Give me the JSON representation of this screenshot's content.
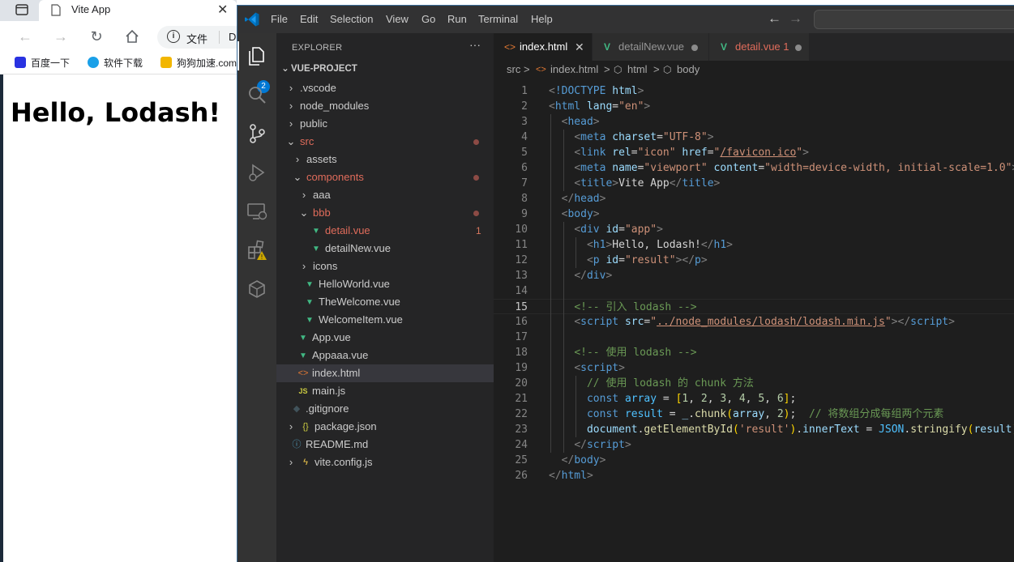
{
  "browser": {
    "tab_title": "Vite App",
    "tab_close": "✕",
    "address_label": "文件",
    "address_text": "D",
    "bookmarks": [
      {
        "label": "百度一下",
        "color": "#2932e1"
      },
      {
        "label": "软件下载",
        "color": "#1aa0e8"
      },
      {
        "label": "狗狗加速.com",
        "color": "#f2b600"
      }
    ],
    "page_heading": "Hello, Lodash!"
  },
  "vscode": {
    "menu": [
      "File",
      "Edit",
      "Selection",
      "View",
      "Go",
      "Run",
      "Terminal",
      "Help"
    ],
    "source_control_badge": "2",
    "explorer": {
      "title": "EXPLORER",
      "more": "···",
      "project": "VUE-PROJECT",
      "items": [
        {
          "label": ".vscode",
          "depth": 0,
          "kind": "folder",
          "open": false
        },
        {
          "label": "node_modules",
          "depth": 0,
          "kind": "folder",
          "open": false
        },
        {
          "label": "public",
          "depth": 0,
          "kind": "folder",
          "open": false
        },
        {
          "label": "src",
          "depth": 0,
          "kind": "folder",
          "open": true,
          "modified": true,
          "dot": true
        },
        {
          "label": "assets",
          "depth": 1,
          "kind": "folder",
          "open": false
        },
        {
          "label": "components",
          "depth": 1,
          "kind": "folder",
          "open": true,
          "modified": true,
          "dot": true
        },
        {
          "label": "aaa",
          "depth": 2,
          "kind": "folder",
          "open": false
        },
        {
          "label": "bbb",
          "depth": 2,
          "kind": "folder",
          "open": true,
          "modified": true,
          "dot": true
        },
        {
          "label": "detail.vue",
          "depth": 3,
          "kind": "vue",
          "modified": true,
          "count": "1"
        },
        {
          "label": "detailNew.vue",
          "depth": 3,
          "kind": "vue"
        },
        {
          "label": "icons",
          "depth": 2,
          "kind": "folder",
          "open": false
        },
        {
          "label": "HelloWorld.vue",
          "depth": 2,
          "kind": "vue"
        },
        {
          "label": "TheWelcome.vue",
          "depth": 2,
          "kind": "vue"
        },
        {
          "label": "WelcomeItem.vue",
          "depth": 2,
          "kind": "vue"
        },
        {
          "label": "App.vue",
          "depth": 1,
          "kind": "vue"
        },
        {
          "label": "Appaaa.vue",
          "depth": 1,
          "kind": "vue"
        },
        {
          "label": "index.html",
          "depth": 1,
          "kind": "html",
          "selected": true
        },
        {
          "label": "main.js",
          "depth": 1,
          "kind": "js"
        },
        {
          "label": ".gitignore",
          "depth": 0,
          "kind": "git"
        },
        {
          "label": "package.json",
          "depth": 0,
          "kind": "json",
          "folded": true
        },
        {
          "label": "README.md",
          "depth": 0,
          "kind": "info"
        },
        {
          "label": "vite.config.js",
          "depth": 0,
          "kind": "vite",
          "folded": true
        }
      ]
    },
    "tabs": [
      {
        "label": "index.html",
        "icon": "<>",
        "active": true,
        "close": "✕"
      },
      {
        "label": "detailNew.vue",
        "icon": "V",
        "dirty": true
      },
      {
        "label": "detail.vue 1",
        "icon": "V",
        "dirty": true,
        "modified": true
      }
    ],
    "breadcrumb": [
      "src",
      ">",
      "index.html",
      ">",
      "html",
      ">",
      "body"
    ],
    "current_line": 15,
    "code_lines": [
      [
        [
          "pn",
          "<"
        ],
        [
          "tg",
          "!DOCTYPE"
        ],
        [
          "tt",
          " "
        ],
        [
          "at",
          "html"
        ],
        [
          "pn",
          ">"
        ]
      ],
      [
        [
          "pn",
          "<"
        ],
        [
          "tg",
          "html"
        ],
        [
          "tt",
          " "
        ],
        [
          "at",
          "lang"
        ],
        [
          "df",
          "="
        ],
        [
          "st",
          "\"en\""
        ],
        [
          "pn",
          ">"
        ]
      ],
      [
        [
          "tt",
          "  "
        ],
        [
          "pn",
          "<"
        ],
        [
          "tg",
          "head"
        ],
        [
          "pn",
          ">"
        ]
      ],
      [
        [
          "tt",
          "    "
        ],
        [
          "pn",
          "<"
        ],
        [
          "tg",
          "meta"
        ],
        [
          "tt",
          " "
        ],
        [
          "at",
          "charset"
        ],
        [
          "df",
          "="
        ],
        [
          "st",
          "\"UTF-8\""
        ],
        [
          "pn",
          ">"
        ]
      ],
      [
        [
          "tt",
          "    "
        ],
        [
          "pn",
          "<"
        ],
        [
          "tg",
          "link"
        ],
        [
          "tt",
          " "
        ],
        [
          "at",
          "rel"
        ],
        [
          "df",
          "="
        ],
        [
          "st",
          "\"icon\""
        ],
        [
          "tt",
          " "
        ],
        [
          "at",
          "href"
        ],
        [
          "df",
          "="
        ],
        [
          "st",
          "\""
        ],
        [
          "lk",
          "/favicon.ico"
        ],
        [
          "st",
          "\""
        ],
        [
          "pn",
          ">"
        ]
      ],
      [
        [
          "tt",
          "    "
        ],
        [
          "pn",
          "<"
        ],
        [
          "tg",
          "meta"
        ],
        [
          "tt",
          " "
        ],
        [
          "at",
          "name"
        ],
        [
          "df",
          "="
        ],
        [
          "st",
          "\"viewport\""
        ],
        [
          "tt",
          " "
        ],
        [
          "at",
          "content"
        ],
        [
          "df",
          "="
        ],
        [
          "st",
          "\"width=device-width, initial-scale=1.0\""
        ],
        [
          "pn",
          ">"
        ]
      ],
      [
        [
          "tt",
          "    "
        ],
        [
          "pn",
          "<"
        ],
        [
          "tg",
          "title"
        ],
        [
          "pn",
          ">"
        ],
        [
          "tt",
          "Vite App"
        ],
        [
          "pn",
          "</"
        ],
        [
          "tg",
          "title"
        ],
        [
          "pn",
          ">"
        ]
      ],
      [
        [
          "tt",
          "  "
        ],
        [
          "pn",
          "</"
        ],
        [
          "tg",
          "head"
        ],
        [
          "pn",
          ">"
        ]
      ],
      [
        [
          "tt",
          "  "
        ],
        [
          "pn",
          "<"
        ],
        [
          "tg",
          "body"
        ],
        [
          "pn",
          ">"
        ]
      ],
      [
        [
          "tt",
          "    "
        ],
        [
          "pn",
          "<"
        ],
        [
          "tg",
          "div"
        ],
        [
          "tt",
          " "
        ],
        [
          "at",
          "id"
        ],
        [
          "df",
          "="
        ],
        [
          "st",
          "\"app\""
        ],
        [
          "pn",
          ">"
        ]
      ],
      [
        [
          "tt",
          "      "
        ],
        [
          "pn",
          "<"
        ],
        [
          "tg",
          "h1"
        ],
        [
          "pn",
          ">"
        ],
        [
          "tt",
          "Hello, Lodash!"
        ],
        [
          "pn",
          "</"
        ],
        [
          "tg",
          "h1"
        ],
        [
          "pn",
          ">"
        ]
      ],
      [
        [
          "tt",
          "      "
        ],
        [
          "pn",
          "<"
        ],
        [
          "tg",
          "p"
        ],
        [
          "tt",
          " "
        ],
        [
          "at",
          "id"
        ],
        [
          "df",
          "="
        ],
        [
          "st",
          "\"result\""
        ],
        [
          "pn",
          "></"
        ],
        [
          "tg",
          "p"
        ],
        [
          "pn",
          ">"
        ]
      ],
      [
        [
          "tt",
          "    "
        ],
        [
          "pn",
          "</"
        ],
        [
          "tg",
          "div"
        ],
        [
          "pn",
          ">"
        ]
      ],
      [],
      [
        [
          "tt",
          "    "
        ],
        [
          "cm",
          "<!-- 引入 lodash -->"
        ]
      ],
      [
        [
          "tt",
          "    "
        ],
        [
          "pn",
          "<"
        ],
        [
          "tg",
          "script"
        ],
        [
          "tt",
          " "
        ],
        [
          "at",
          "src"
        ],
        [
          "df",
          "="
        ],
        [
          "st",
          "\""
        ],
        [
          "lk",
          "../node_modules/lodash/lodash.min.js"
        ],
        [
          "st",
          "\""
        ],
        [
          "pn",
          "></"
        ],
        [
          "tg",
          "script"
        ],
        [
          "pn",
          ">"
        ]
      ],
      [],
      [
        [
          "tt",
          "    "
        ],
        [
          "cm",
          "<!-- 使用 lodash -->"
        ]
      ],
      [
        [
          "tt",
          "    "
        ],
        [
          "pn",
          "<"
        ],
        [
          "tg",
          "script"
        ],
        [
          "pn",
          ">"
        ]
      ],
      [
        [
          "tt",
          "      "
        ],
        [
          "cm",
          "// 使用 lodash 的 chunk 方法"
        ]
      ],
      [
        [
          "tt",
          "      "
        ],
        [
          "kw",
          "const"
        ],
        [
          "tt",
          " "
        ],
        [
          "cs",
          "array"
        ],
        [
          "df",
          " = "
        ],
        [
          "b1",
          "["
        ],
        [
          "nu",
          "1"
        ],
        [
          "df",
          ", "
        ],
        [
          "nu",
          "2"
        ],
        [
          "df",
          ", "
        ],
        [
          "nu",
          "3"
        ],
        [
          "df",
          ", "
        ],
        [
          "nu",
          "4"
        ],
        [
          "df",
          ", "
        ],
        [
          "nu",
          "5"
        ],
        [
          "df",
          ", "
        ],
        [
          "nu",
          "6"
        ],
        [
          "b1",
          "]"
        ],
        [
          "df",
          ";"
        ]
      ],
      [
        [
          "tt",
          "      "
        ],
        [
          "kw",
          "const"
        ],
        [
          "tt",
          " "
        ],
        [
          "cs",
          "result"
        ],
        [
          "df",
          " = "
        ],
        [
          "vr",
          "_"
        ],
        [
          "df",
          "."
        ],
        [
          "fn",
          "chunk"
        ],
        [
          "b1",
          "("
        ],
        [
          "vr",
          "array"
        ],
        [
          "df",
          ", "
        ],
        [
          "nu",
          "2"
        ],
        [
          "b1",
          ")"
        ],
        [
          "df",
          ";  "
        ],
        [
          "cm",
          "// 将数组分成每组两个元素"
        ]
      ],
      [
        [
          "tt",
          "      "
        ],
        [
          "vr",
          "document"
        ],
        [
          "df",
          "."
        ],
        [
          "fn",
          "getElementById"
        ],
        [
          "b1",
          "("
        ],
        [
          "st",
          "'result'"
        ],
        [
          "b1",
          ")"
        ],
        [
          "df",
          "."
        ],
        [
          "vr",
          "innerText"
        ],
        [
          "df",
          " = "
        ],
        [
          "cs",
          "JSON"
        ],
        [
          "df",
          "."
        ],
        [
          "fn",
          "stringify"
        ],
        [
          "b1",
          "("
        ],
        [
          "vr",
          "result"
        ],
        [
          "b1",
          ")"
        ],
        [
          "df",
          ";"
        ]
      ],
      [
        [
          "tt",
          "    "
        ],
        [
          "pn",
          "</"
        ],
        [
          "tg",
          "script"
        ],
        [
          "pn",
          ">"
        ]
      ],
      [
        [
          "tt",
          "  "
        ],
        [
          "pn",
          "</"
        ],
        [
          "tg",
          "body"
        ],
        [
          "pn",
          ">"
        ]
      ],
      [
        [
          "pn",
          "</"
        ],
        [
          "tg",
          "html"
        ],
        [
          "pn",
          ">"
        ]
      ]
    ]
  }
}
